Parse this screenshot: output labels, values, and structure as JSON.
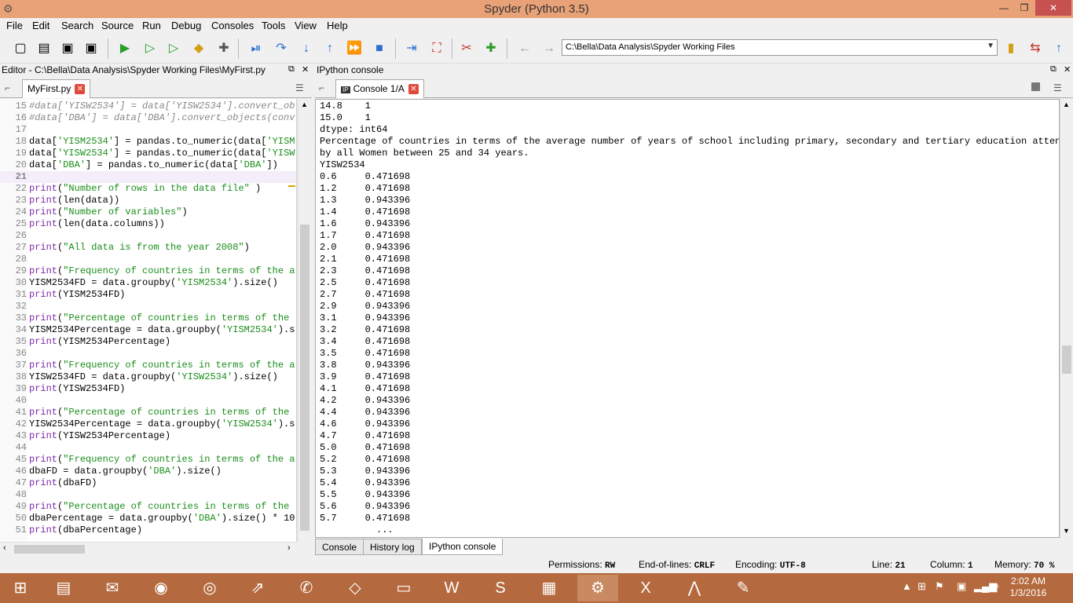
{
  "window": {
    "title": "Spyder (Python 3.5)",
    "minimize": "—",
    "maximize": "❐",
    "close": "✕"
  },
  "menu": [
    "File",
    "Edit",
    "Search",
    "Source",
    "Run",
    "Debug",
    "Consoles",
    "Tools",
    "View",
    "Help"
  ],
  "toolbar": {
    "path": "C:\\Bella\\Data Analysis\\Spyder Working Files"
  },
  "editor": {
    "pane_title": "Editor - C:\\Bella\\Data Analysis\\Spyder Working Files\\MyFirst.py",
    "tab_label": "MyFirst.py",
    "lines": [
      {
        "n": "15",
        "t": "#data['YISW2534'] = data['YISW2534'].convert_ob",
        "c": "cmt"
      },
      {
        "n": "16",
        "t": "#data['DBA'] = data['DBA'].convert_objects(conv",
        "c": "cmt"
      },
      {
        "n": "17",
        "t": "",
        "c": ""
      },
      {
        "n": "18",
        "t": "data['YISM2534'] = pandas.to_numeric(data['YISM",
        "c": ""
      },
      {
        "n": "19",
        "t": "data['YISW2534'] = pandas.to_numeric(data['YISW",
        "c": ""
      },
      {
        "n": "20",
        "t": "data['DBA'] = pandas.to_numeric(data['DBA'])",
        "c": ""
      },
      {
        "n": "21",
        "t": "",
        "c": "cur"
      },
      {
        "n": "22",
        "t": "print(\"Number of rows in the data file\" )",
        "c": ""
      },
      {
        "n": "23",
        "t": "print(len(data))",
        "c": ""
      },
      {
        "n": "24",
        "t": "print(\"Number of variables\")",
        "c": ""
      },
      {
        "n": "25",
        "t": "print(len(data.columns))",
        "c": ""
      },
      {
        "n": "26",
        "t": "",
        "c": ""
      },
      {
        "n": "27",
        "t": "print(\"All data is from the year 2008\")",
        "c": ""
      },
      {
        "n": "28",
        "t": "",
        "c": ""
      },
      {
        "n": "29",
        "t": "print(\"Frequency of countries in terms of the a",
        "c": ""
      },
      {
        "n": "30",
        "t": "YISM2534FD = data.groupby('YISM2534').size()",
        "c": ""
      },
      {
        "n": "31",
        "t": "print(YISM2534FD)",
        "c": ""
      },
      {
        "n": "32",
        "t": "",
        "c": ""
      },
      {
        "n": "33",
        "t": "print(\"Percentage of countries in terms of the",
        "c": ""
      },
      {
        "n": "34",
        "t": "YISM2534Percentage = data.groupby('YISM2534').s",
        "c": ""
      },
      {
        "n": "35",
        "t": "print(YISM2534Percentage)",
        "c": ""
      },
      {
        "n": "36",
        "t": "",
        "c": ""
      },
      {
        "n": "37",
        "t": "print(\"Frequency of countries in terms of the a",
        "c": ""
      },
      {
        "n": "38",
        "t": "YISW2534FD = data.groupby('YISW2534').size()",
        "c": ""
      },
      {
        "n": "39",
        "t": "print(YISW2534FD)",
        "c": ""
      },
      {
        "n": "40",
        "t": "",
        "c": ""
      },
      {
        "n": "41",
        "t": "print(\"Percentage of countries in terms of the",
        "c": ""
      },
      {
        "n": "42",
        "t": "YISW2534Percentage = data.groupby('YISW2534').s",
        "c": ""
      },
      {
        "n": "43",
        "t": "print(YISW2534Percentage)",
        "c": ""
      },
      {
        "n": "44",
        "t": "",
        "c": ""
      },
      {
        "n": "45",
        "t": "print(\"Frequency of countries in terms of the a",
        "c": ""
      },
      {
        "n": "46",
        "t": "dbaFD = data.groupby('DBA').size()",
        "c": ""
      },
      {
        "n": "47",
        "t": "print(dbaFD)",
        "c": ""
      },
      {
        "n": "48",
        "t": "",
        "c": ""
      },
      {
        "n": "49",
        "t": "print(\"Percentage of countries in terms of the",
        "c": ""
      },
      {
        "n": "50",
        "t": "dbaPercentage = data.groupby('DBA').size() * 10",
        "c": ""
      },
      {
        "n": "51",
        "t": "print(dbaPercentage)",
        "c": ""
      }
    ]
  },
  "console": {
    "pane_title": "IPython console",
    "tab_label": "Console 1/A",
    "lines": [
      "14.8    1",
      "15.0    1",
      "dtype: int64",
      "Percentage of countries in terms of the average number of years of school including primary, secondary and tertiary education attended",
      "by all Women between 25 and 34 years.",
      "YISW2534",
      "0.6     0.471698",
      "1.2     0.471698",
      "1.3     0.943396",
      "1.4     0.471698",
      "1.6     0.943396",
      "1.7     0.471698",
      "2.0     0.943396",
      "2.1     0.471698",
      "2.3     0.471698",
      "2.5     0.471698",
      "2.7     0.471698",
      "2.9     0.943396",
      "3.1     0.943396",
      "3.2     0.471698",
      "3.4     0.471698",
      "3.5     0.471698",
      "3.8     0.943396",
      "3.9     0.471698",
      "4.1     0.471698",
      "4.2     0.943396",
      "4.4     0.943396",
      "4.6     0.943396",
      "4.7     0.471698",
      "5.0     0.471698",
      "5.2     0.471698",
      "5.3     0.943396",
      "5.4     0.943396",
      "5.5     0.943396",
      "5.6     0.943396",
      "5.7     0.471698",
      "          ..."
    ],
    "bottom_tabs": [
      "Console",
      "History log",
      "IPython console"
    ]
  },
  "status": {
    "permissions_label": "Permissions:",
    "permissions": "RW",
    "eol_label": "End-of-lines:",
    "eol": "CRLF",
    "encoding_label": "Encoding:",
    "encoding": "UTF-8",
    "line_label": "Line:",
    "line": "21",
    "column_label": "Column:",
    "column": "1",
    "memory_label": "Memory:",
    "memory": "70 %"
  },
  "taskbar": {
    "time": "2:02 AM",
    "date": "1/3/2016"
  }
}
